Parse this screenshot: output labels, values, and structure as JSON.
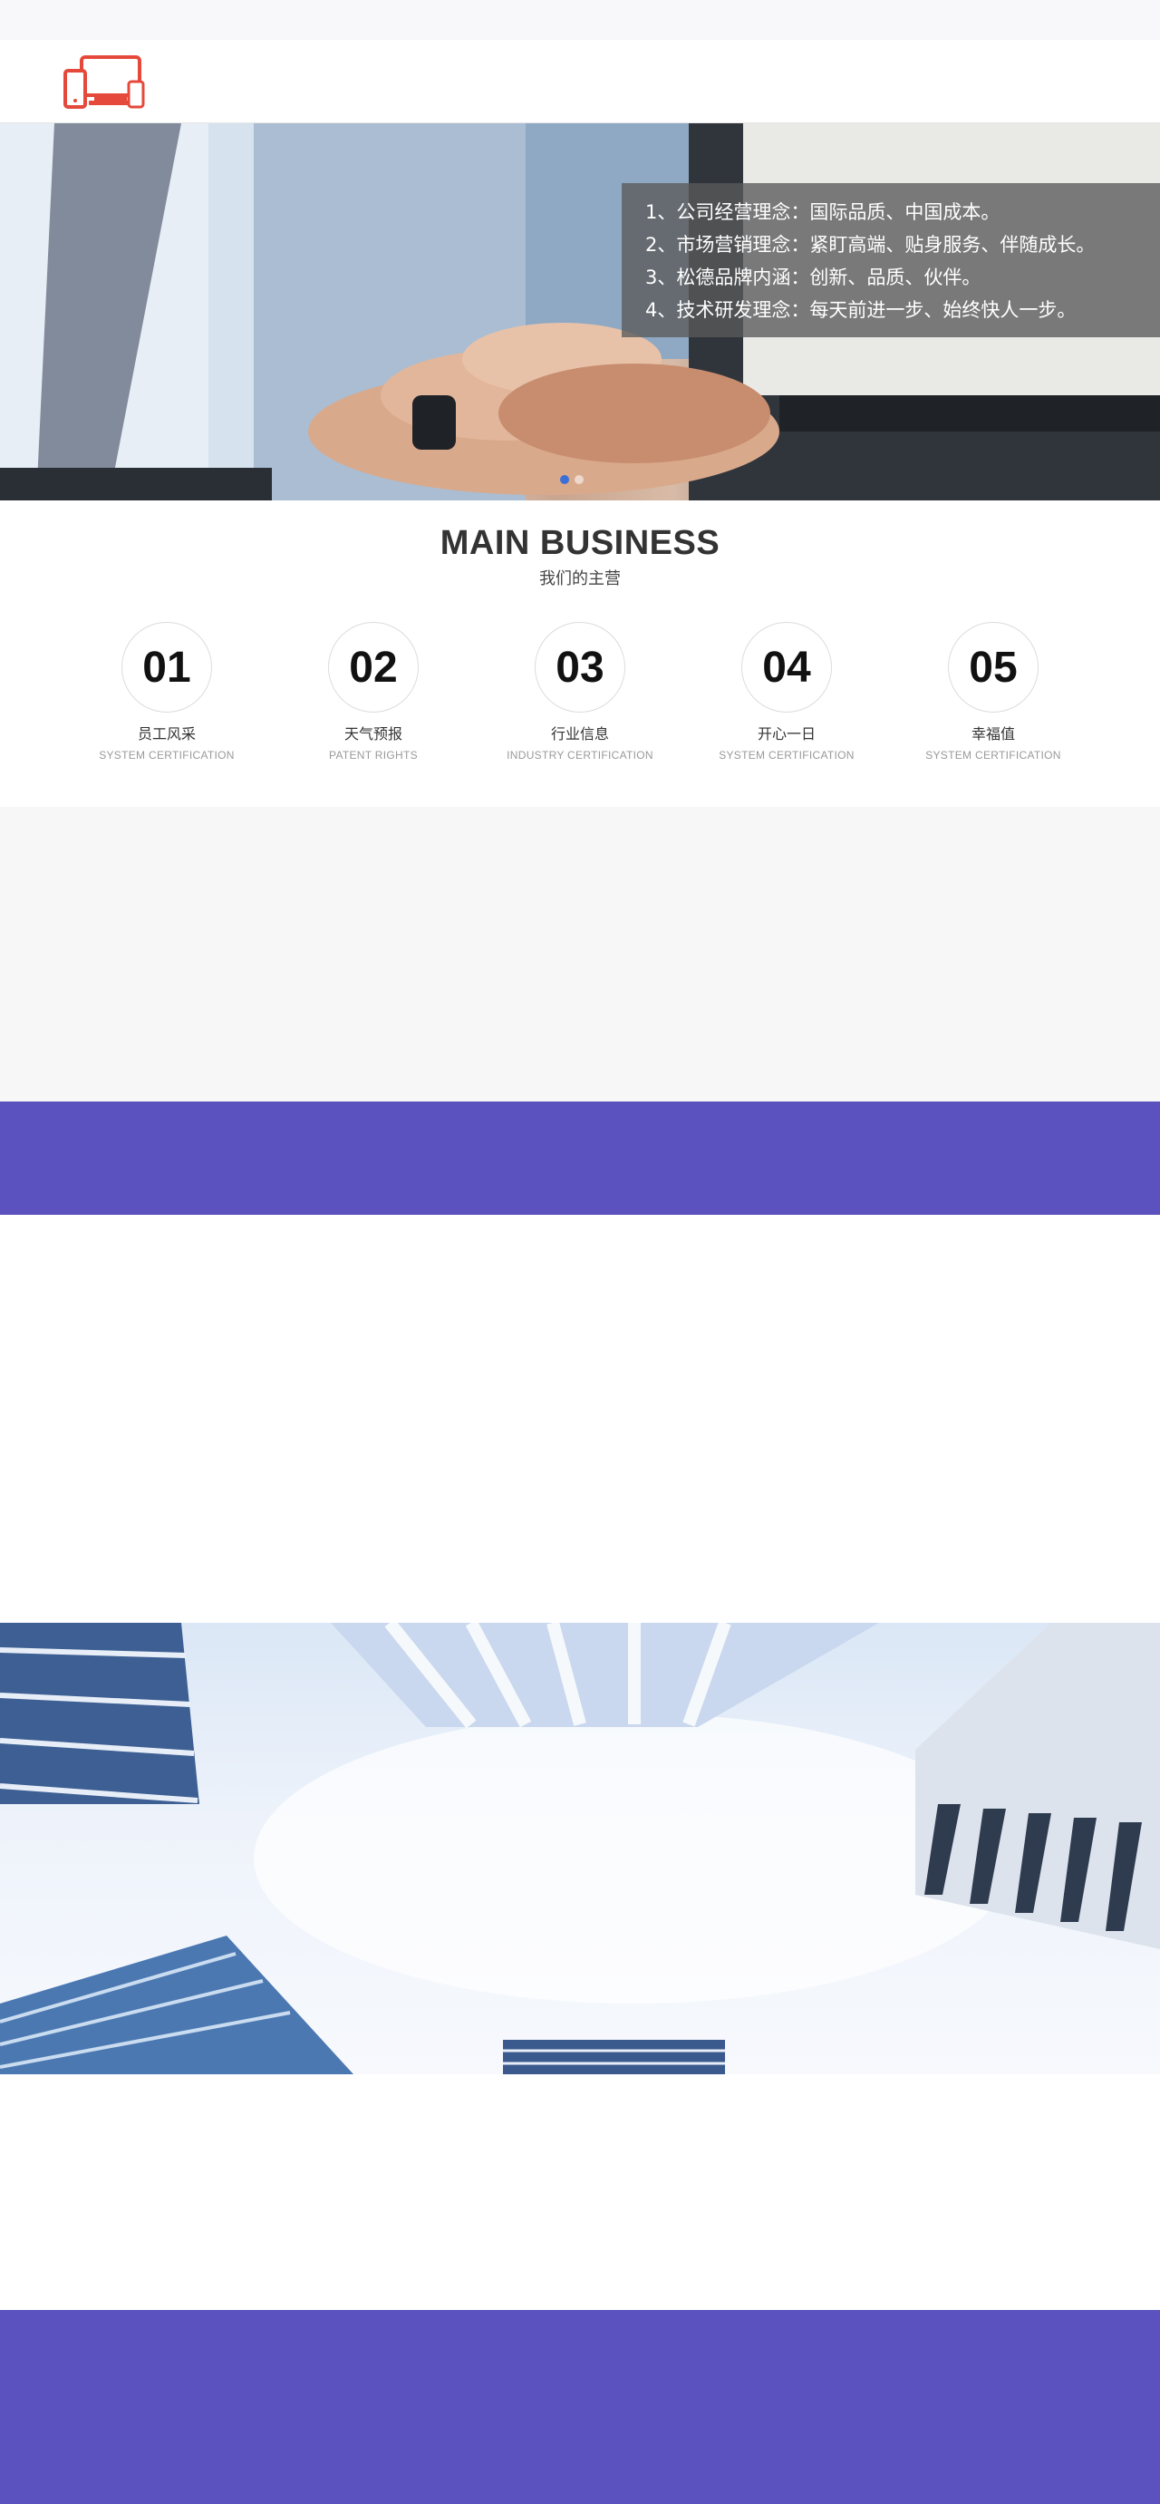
{
  "logo": {
    "icon": "devices-icon",
    "color": "#e4493b"
  },
  "banner": {
    "lines": [
      "1、公司经营理念：国际品质、中国成本。",
      "2、市场营销理念：紧盯高端、贴身服务、伴随成长。",
      "3、松德品牌内涵：创新、品质、伙伴。",
      "4、技术研发理念：每天前进一步、始终快人一步。"
    ],
    "slides": 2,
    "active_slide": 1
  },
  "business": {
    "title": "MAIN BUSINESS",
    "subtitle": "我们的主营",
    "items": [
      {
        "num": "01",
        "name": "员工风采",
        "en": "SYSTEM CERTIFICATION"
      },
      {
        "num": "02",
        "name": "天气预报",
        "en": "PATENT RIGHTS"
      },
      {
        "num": "03",
        "name": "行业信息",
        "en": "INDUSTRY CERTIFICATION"
      },
      {
        "num": "04",
        "name": "开心一日",
        "en": "SYSTEM CERTIFICATION"
      },
      {
        "num": "05",
        "name": "幸福值",
        "en": "SYSTEM CERTIFICATION"
      }
    ]
  },
  "colors": {
    "accent_purple": "#5b51bf",
    "section_gray": "#f8f7f7",
    "slider_dot_active": "#3a6fd8"
  }
}
